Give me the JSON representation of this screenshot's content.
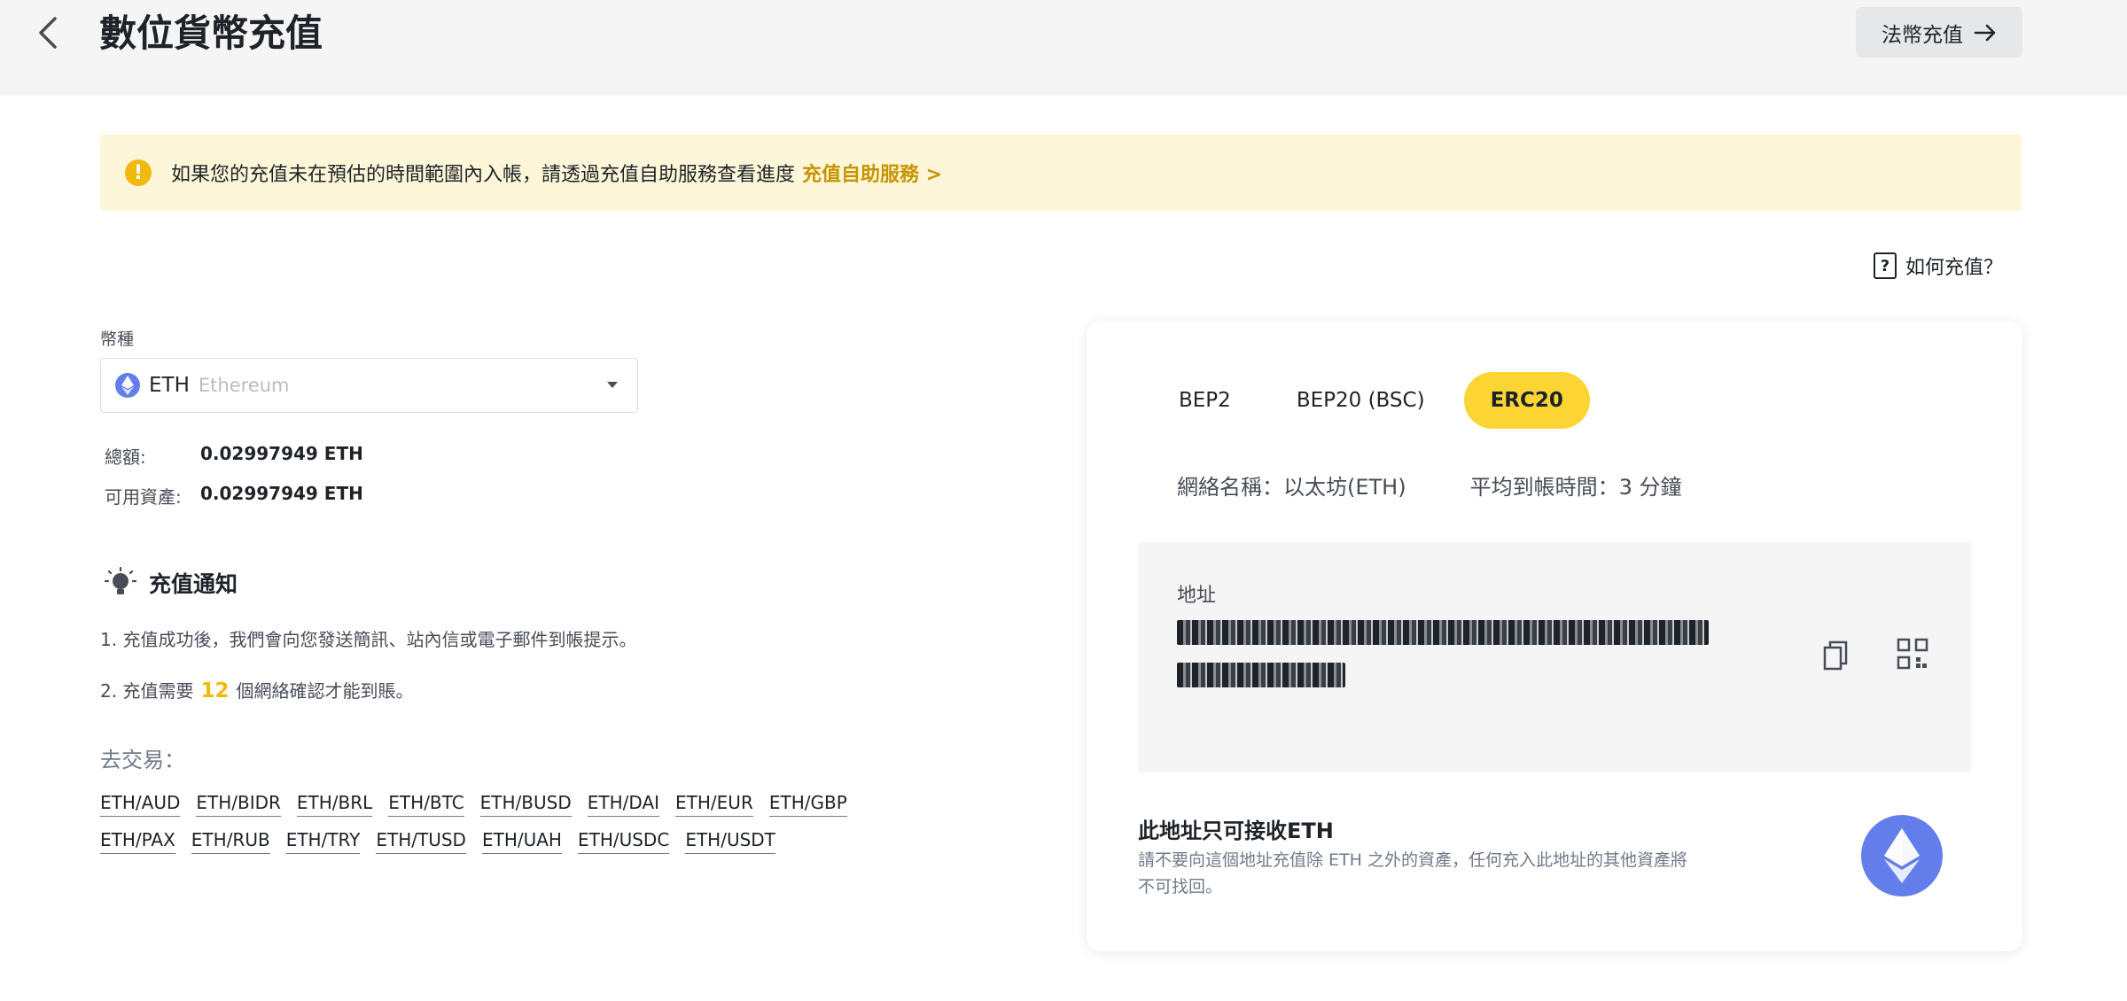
{
  "header": {
    "title": "數位貨幣充值",
    "fiat_button": "法幣充值",
    "back_icon": "chevron-left-icon",
    "arrow_icon": "arrow-right-icon"
  },
  "banner": {
    "text": "如果您的充值未在預估的時間範圍內入帳，請透過充值自助服務查看進度",
    "link": "充值自助服務 >"
  },
  "help": {
    "label": "如何充值？"
  },
  "coin": {
    "label": "幣種",
    "symbol": "ETH",
    "name": "Ethereum"
  },
  "balance": {
    "total_label": "總額:",
    "total_value": "0.02997949 ETH",
    "available_label": "可用資產:",
    "available_value": "0.02997949 ETH"
  },
  "notice": {
    "title": "充值通知",
    "line1": "1. 充值成功後，我們會向您發送簡訊、站內信或電子郵件到帳提示。",
    "line2_prefix": "2. 充值需要",
    "line2_count": "12",
    "line2_suffix": "個網絡確認才能到賬。"
  },
  "trade": {
    "label": "去交易：",
    "row1": [
      "ETH/AUD",
      "ETH/BIDR",
      "ETH/BRL",
      "ETH/BTC",
      "ETH/BUSD",
      "ETH/DAI",
      "ETH/EUR",
      "ETH/GBP"
    ],
    "row2": [
      "ETH/PAX",
      "ETH/RUB",
      "ETH/TRY",
      "ETH/TUSD",
      "ETH/UAH",
      "ETH/USDC",
      "ETH/USDT"
    ]
  },
  "networks": {
    "tabs": [
      "BEP2",
      "BEP20 (BSC)",
      "ERC20"
    ],
    "active": "ERC20",
    "network_name": "網絡名稱：以太坊(ETH)",
    "arrival_time": "平均到帳時間：3 分鐘"
  },
  "address": {
    "label": "地址",
    "copy_icon": "copy-icon",
    "qr_icon": "qr-code-icon"
  },
  "warning": {
    "title": "此地址只可接收ETH",
    "desc": "請不要向這個地址充值除 ETH 之外的資產，任何充入此地址的其他資產將不可找回。"
  },
  "colors": {
    "accent": "#fcd535",
    "link": "#c99400",
    "highlight": "#f0b90b",
    "eth": "#627eea",
    "banner_bg": "#fdf6d8"
  }
}
